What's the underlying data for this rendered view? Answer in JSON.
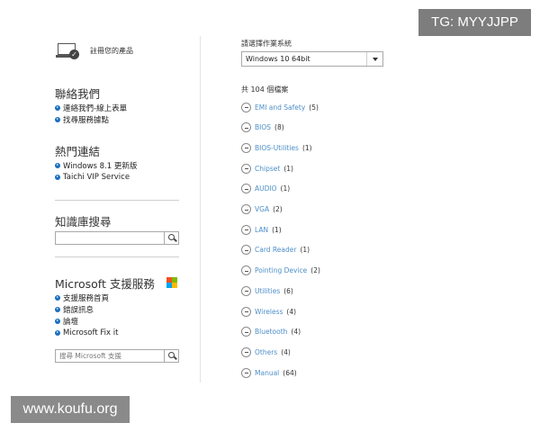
{
  "watermarks": {
    "tg": "TG: MYYJJPP",
    "site": "www.koufu.org"
  },
  "left": {
    "product_label": "註冊您的產品",
    "contact": {
      "title": "聯絡我們",
      "links": [
        "連絡我們-線上表單",
        "找尋服務據點"
      ]
    },
    "popular": {
      "title": "熱門連結",
      "links": [
        "Windows 8.1 更新版",
        "Taichi VIP Service"
      ]
    },
    "kb": {
      "title": "知識庫搜尋",
      "search_value": ""
    },
    "microsoft": {
      "title": "Microsoft 支援服務",
      "links": [
        "支援服務首頁",
        "錯誤訊息",
        "論壇",
        "Microsoft Fix it"
      ],
      "search_placeholder": "搜尋 Microsoft 支援",
      "logo_colors": [
        "#f25022",
        "#7fba00",
        "#00a4ef",
        "#ffb900"
      ]
    }
  },
  "right": {
    "os_label": "請選擇作業系統",
    "os_selected": "Windows 10 64bit",
    "count_label": "共 104 個檔案",
    "categories": [
      {
        "name": "EMI and Safety",
        "count": "(5)"
      },
      {
        "name": "BIOS",
        "count": "(8)"
      },
      {
        "name": "BIOS-Utilities",
        "count": "(1)"
      },
      {
        "name": "Chipset",
        "count": "(1)"
      },
      {
        "name": "AUDIO",
        "count": "(1)"
      },
      {
        "name": "VGA",
        "count": "(2)"
      },
      {
        "name": "LAN",
        "count": "(1)"
      },
      {
        "name": "Card Reader",
        "count": "(1)"
      },
      {
        "name": "Pointing Device",
        "count": "(2)"
      },
      {
        "name": "Utilities",
        "count": "(6)"
      },
      {
        "name": "Wireless",
        "count": "(4)"
      },
      {
        "name": "Bluetooth",
        "count": "(4)"
      },
      {
        "name": "Others",
        "count": "(4)"
      },
      {
        "name": "Manual",
        "count": "(64)"
      }
    ]
  },
  "colors": {
    "link_blue": "#4d8fc8",
    "bullet_blue": "#1a6fbf"
  }
}
